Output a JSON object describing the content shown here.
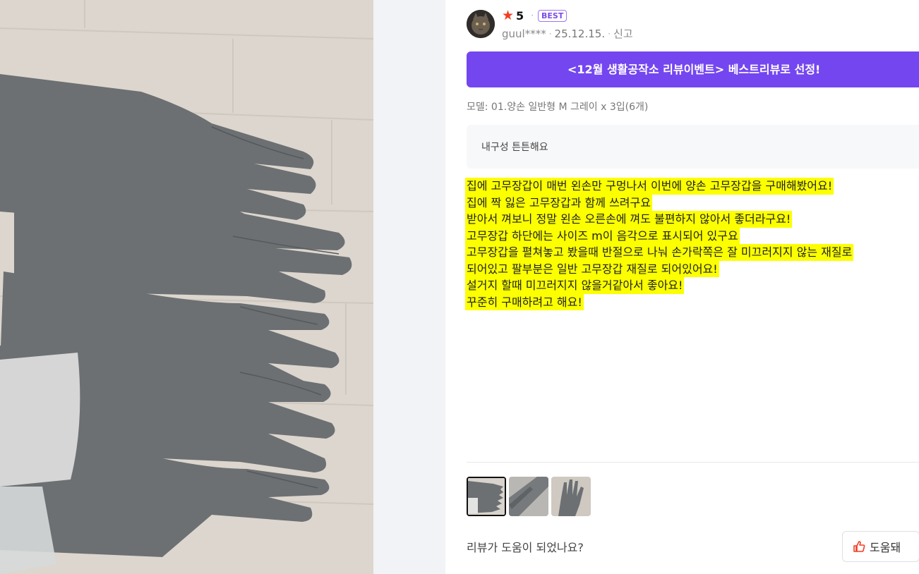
{
  "review": {
    "rating": "5",
    "badge": "BEST",
    "username": "guul****",
    "date": "25.12.15.",
    "report_label": "신고",
    "banner": "<12월 생활공작소 리뷰이벤트> 베스트리뷰로 선정!",
    "option": "모델: 01.양손 일반형 M 그레이 x 3입(6개)",
    "attribute": "내구성 튼튼해요",
    "body_lines": [
      "집에 고무장갑이 매번 왼손만 구멍나서 이번에 양손 고무장갑을 구매해봤어요!",
      "집에 짝 잃은 고무장갑과 함께 쓰려구요",
      "받아서 껴보니 정말 왼손 오른손에 껴도 불편하지 않아서 좋더라구요!",
      "고무장갑 하단에는 사이즈 m이 음각으로 표시되어 있구요",
      "고무장갑을 펼쳐놓고 봤을때 반절으로 나눠 손가락쪽은 잘 미끄러지지 않는 재질로",
      "되어있고 팔부분은 일반 고무장갑 재질로 되어있어요!",
      "설거지 할때 미끄러지지 않을거같아서 좋아요!",
      "꾸준히 구매하려고 해요!"
    ],
    "highlight_color": "#fbff00",
    "helpful_question": "리뷰가 도움이 되었나요?",
    "helpful_button": "도움돼",
    "thumbnails_count": 3
  },
  "colors": {
    "accent": "#7446f0",
    "star": "#f23d23",
    "glove": "#6b6f72"
  }
}
